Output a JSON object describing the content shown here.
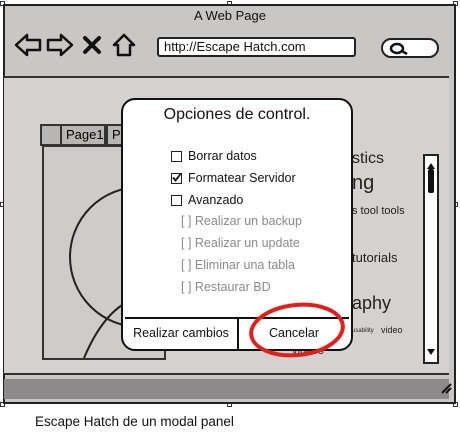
{
  "window": {
    "title": "A Web Page"
  },
  "browser": {
    "url": "http://Escape Hatch.com",
    "nav_icons": [
      "back-arrow-icon",
      "forward-arrow-icon",
      "close-x-icon",
      "home-icon"
    ]
  },
  "tabs": [
    "Page1",
    "P"
  ],
  "background_words": [
    "stics",
    "ng",
    "s tool tools",
    "tutorials",
    "aphy",
    "usability",
    "video",
    "videos"
  ],
  "modal": {
    "title": "Opciones de control.",
    "options": [
      {
        "label": "Borrar datos",
        "checked": false
      },
      {
        "label": "Formatear Servidor",
        "checked": true
      },
      {
        "label": "Avanzado",
        "checked": false
      }
    ],
    "sub_options": [
      "[ ] Realizar un backup",
      "[ ] Realizar un update",
      "[ ] Eliminar una tabla",
      "[ ] Restaurar BD"
    ],
    "buttons": {
      "apply": "Realizar cambios",
      "cancel": "Cancelar"
    }
  },
  "colors": {
    "highlight_circle": "#e0201c"
  },
  "caption": "Escape Hatch de un modal panel"
}
